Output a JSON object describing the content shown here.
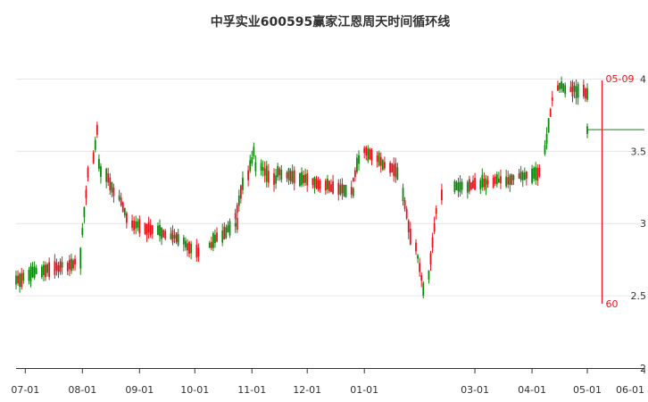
{
  "chart_data": {
    "type": "candlestick",
    "title": "中孚实业600595赢家江恩周天时间循环线",
    "xlabel": "",
    "ylabel": "",
    "ylim": [
      2,
      4.25
    ],
    "y_ticks": [
      "2",
      "2.5",
      "3",
      "3.5",
      "4"
    ],
    "x_ticks": [
      "07-01",
      "08-01",
      "09-01",
      "10-01",
      "11-01",
      "12-01",
      "01-01",
      "03-01",
      "04-01",
      "05-01",
      "06-01"
    ],
    "colors": {
      "up": "#e8121c",
      "down": "#0a8a0a",
      "marker": "#e8121c",
      "grid": "#e6e6e6"
    },
    "segments": [
      {
        "start": "2023-06-26",
        "count": 5,
        "from": 2.6,
        "to": 2.62
      },
      {
        "start": "2023-07-01",
        "count": 21,
        "from": 2.65,
        "to": 2.73
      },
      {
        "start": "2023-07-31",
        "count": 5,
        "from": 2.8,
        "to": 3.35
      },
      {
        "start": "2023-08-07",
        "count": 3,
        "from": 3.45,
        "to": 3.65
      },
      {
        "start": "2023-08-10",
        "count": 12,
        "from": 3.4,
        "to": 3.05
      },
      {
        "start": "2023-08-26",
        "count": 20,
        "from": 3.0,
        "to": 2.9
      },
      {
        "start": "2023-09-22",
        "count": 8,
        "from": 2.88,
        "to": 2.8
      },
      {
        "start": "2023-10-07",
        "count": 12,
        "from": 2.85,
        "to": 3.0
      },
      {
        "start": "2023-10-23",
        "count": 9,
        "from": 3.05,
        "to": 3.5
      },
      {
        "start": "2023-11-03",
        "count": 8,
        "from": 3.4,
        "to": 3.3
      },
      {
        "start": "2023-11-15",
        "count": 30,
        "from": 3.35,
        "to": 3.22
      },
      {
        "start": "2023-12-26",
        "count": 5,
        "from": 3.3,
        "to": 3.5
      },
      {
        "start": "2024-01-02",
        "count": 14,
        "from": 3.5,
        "to": 3.35
      },
      {
        "start": "2024-01-22",
        "count": 10,
        "from": 3.2,
        "to": 2.55
      },
      {
        "start": "2024-02-05",
        "count": 6,
        "from": 2.65,
        "to": 3.2
      },
      {
        "start": "2024-02-19",
        "count": 20,
        "from": 3.25,
        "to": 3.3
      },
      {
        "start": "2024-03-18",
        "count": 15,
        "from": 3.3,
        "to": 3.35
      },
      {
        "start": "2024-04-08",
        "count": 6,
        "from": 3.5,
        "to": 3.95
      },
      {
        "start": "2024-04-16",
        "count": 12,
        "from": 3.95,
        "to": 3.9
      },
      {
        "start": "2024-05-01",
        "count": 1,
        "from": 3.65,
        "to": 3.65
      }
    ],
    "last_close": 3.65,
    "cycle_marker": {
      "label": "05-09",
      "value_label": "60",
      "date": "2024-05-09"
    },
    "grid": true,
    "legend": "none"
  }
}
